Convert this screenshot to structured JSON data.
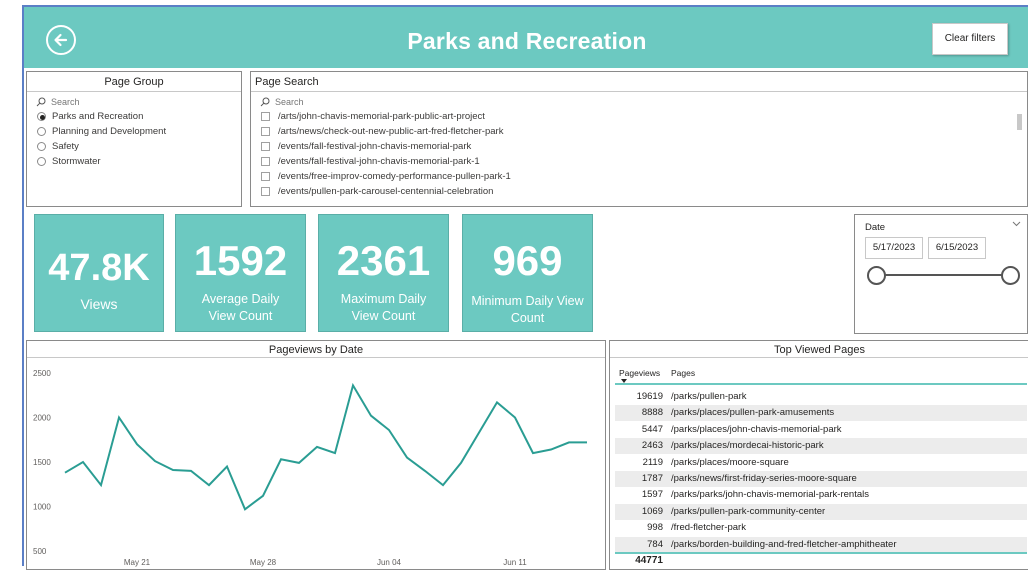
{
  "header": {
    "title": "Parks and Recreation",
    "clear_filters": "Clear filters"
  },
  "page_group": {
    "title": "Page Group",
    "search_placeholder": "Search",
    "options": [
      {
        "label": "Parks and Recreation",
        "selected": true
      },
      {
        "label": "Planning and Development",
        "selected": false
      },
      {
        "label": "Safety",
        "selected": false
      },
      {
        "label": "Stormwater",
        "selected": false
      }
    ]
  },
  "page_search": {
    "title": "Page Search",
    "search_placeholder": "Search",
    "items": [
      "/arts/john-chavis-memorial-park-public-art-project",
      "/arts/news/check-out-new-public-art-fred-fletcher-park",
      "/events/fall-festival-john-chavis-memorial-park",
      "/events/fall-festival-john-chavis-memorial-park-1",
      "/events/free-improv-comedy-performance-pullen-park-1",
      "/events/pullen-park-carousel-centennial-celebration"
    ]
  },
  "kpis": {
    "views": {
      "value": "47.8K",
      "label": "Views"
    },
    "avg": {
      "value": "1592",
      "label_1": "Average Daily",
      "label_2": "View Count"
    },
    "max": {
      "value": "2361",
      "label_1": "Maximum Daily",
      "label_2": "View Count"
    },
    "min": {
      "value": "969",
      "label_1": "Minimum Daily View",
      "label_2": "Count"
    }
  },
  "date_slicer": {
    "title": "Date",
    "start": "5/17/2023",
    "end": "6/15/2023"
  },
  "colors": {
    "accent": "#6cc9c1",
    "line": "#2a9d93"
  },
  "chart_data": {
    "type": "line",
    "title": "Pageviews by Date",
    "xlabel": "",
    "ylabel": "",
    "ylim": [
      500,
      2500
    ],
    "yticks": [
      "2500",
      "2000",
      "1500",
      "1000",
      "500"
    ],
    "xticks": [
      {
        "label": "May 21",
        "x": "2023-05-21"
      },
      {
        "label": "May 28",
        "x": "2023-05-28"
      },
      {
        "label": "Jun 04",
        "x": "2023-06-04"
      },
      {
        "label": "Jun 11",
        "x": "2023-06-11"
      }
    ],
    "x": [
      "2023-05-17",
      "2023-05-18",
      "2023-05-19",
      "2023-05-20",
      "2023-05-21",
      "2023-05-22",
      "2023-05-23",
      "2023-05-24",
      "2023-05-25",
      "2023-05-26",
      "2023-05-27",
      "2023-05-28",
      "2023-05-29",
      "2023-05-30",
      "2023-05-31",
      "2023-06-01",
      "2023-06-02",
      "2023-06-03",
      "2023-06-04",
      "2023-06-05",
      "2023-06-06",
      "2023-06-07",
      "2023-06-08",
      "2023-06-09",
      "2023-06-10",
      "2023-06-11",
      "2023-06-12",
      "2023-06-13",
      "2023-06-14",
      "2023-06-15"
    ],
    "series": [
      {
        "values": [
          1380,
          1500,
          1240,
          2000,
          1700,
          1510,
          1410,
          1400,
          1240,
          1450,
          969,
          1120,
          1530,
          1490,
          1670,
          1600,
          2361,
          2020,
          1860,
          1550,
          1400,
          1240,
          1490,
          1830,
          2170,
          2000,
          1600,
          1640,
          1720,
          1720
        ]
      }
    ],
    "grid": false
  },
  "table": {
    "title": "Top Viewed Pages",
    "col_views": "Pageviews",
    "col_pages": "Pages",
    "rows": [
      {
        "views": "19619",
        "page": "/parks/pullen-park"
      },
      {
        "views": "8888",
        "page": "/parks/places/pullen-park-amusements"
      },
      {
        "views": "5447",
        "page": "/parks/places/john-chavis-memorial-park"
      },
      {
        "views": "2463",
        "page": "/parks/places/mordecai-historic-park"
      },
      {
        "views": "2119",
        "page": "/parks/places/moore-square"
      },
      {
        "views": "1787",
        "page": "/parks/news/first-friday-series-moore-square"
      },
      {
        "views": "1597",
        "page": "/parks/parks/john-chavis-memorial-park-rentals"
      },
      {
        "views": "1069",
        "page": "/parks/pullen-park-community-center"
      },
      {
        "views": "998",
        "page": "/fred-fletcher-park"
      },
      {
        "views": "784",
        "page": "/parks/borden-building-and-fred-fletcher-amphitheater"
      }
    ],
    "total": "44771"
  }
}
